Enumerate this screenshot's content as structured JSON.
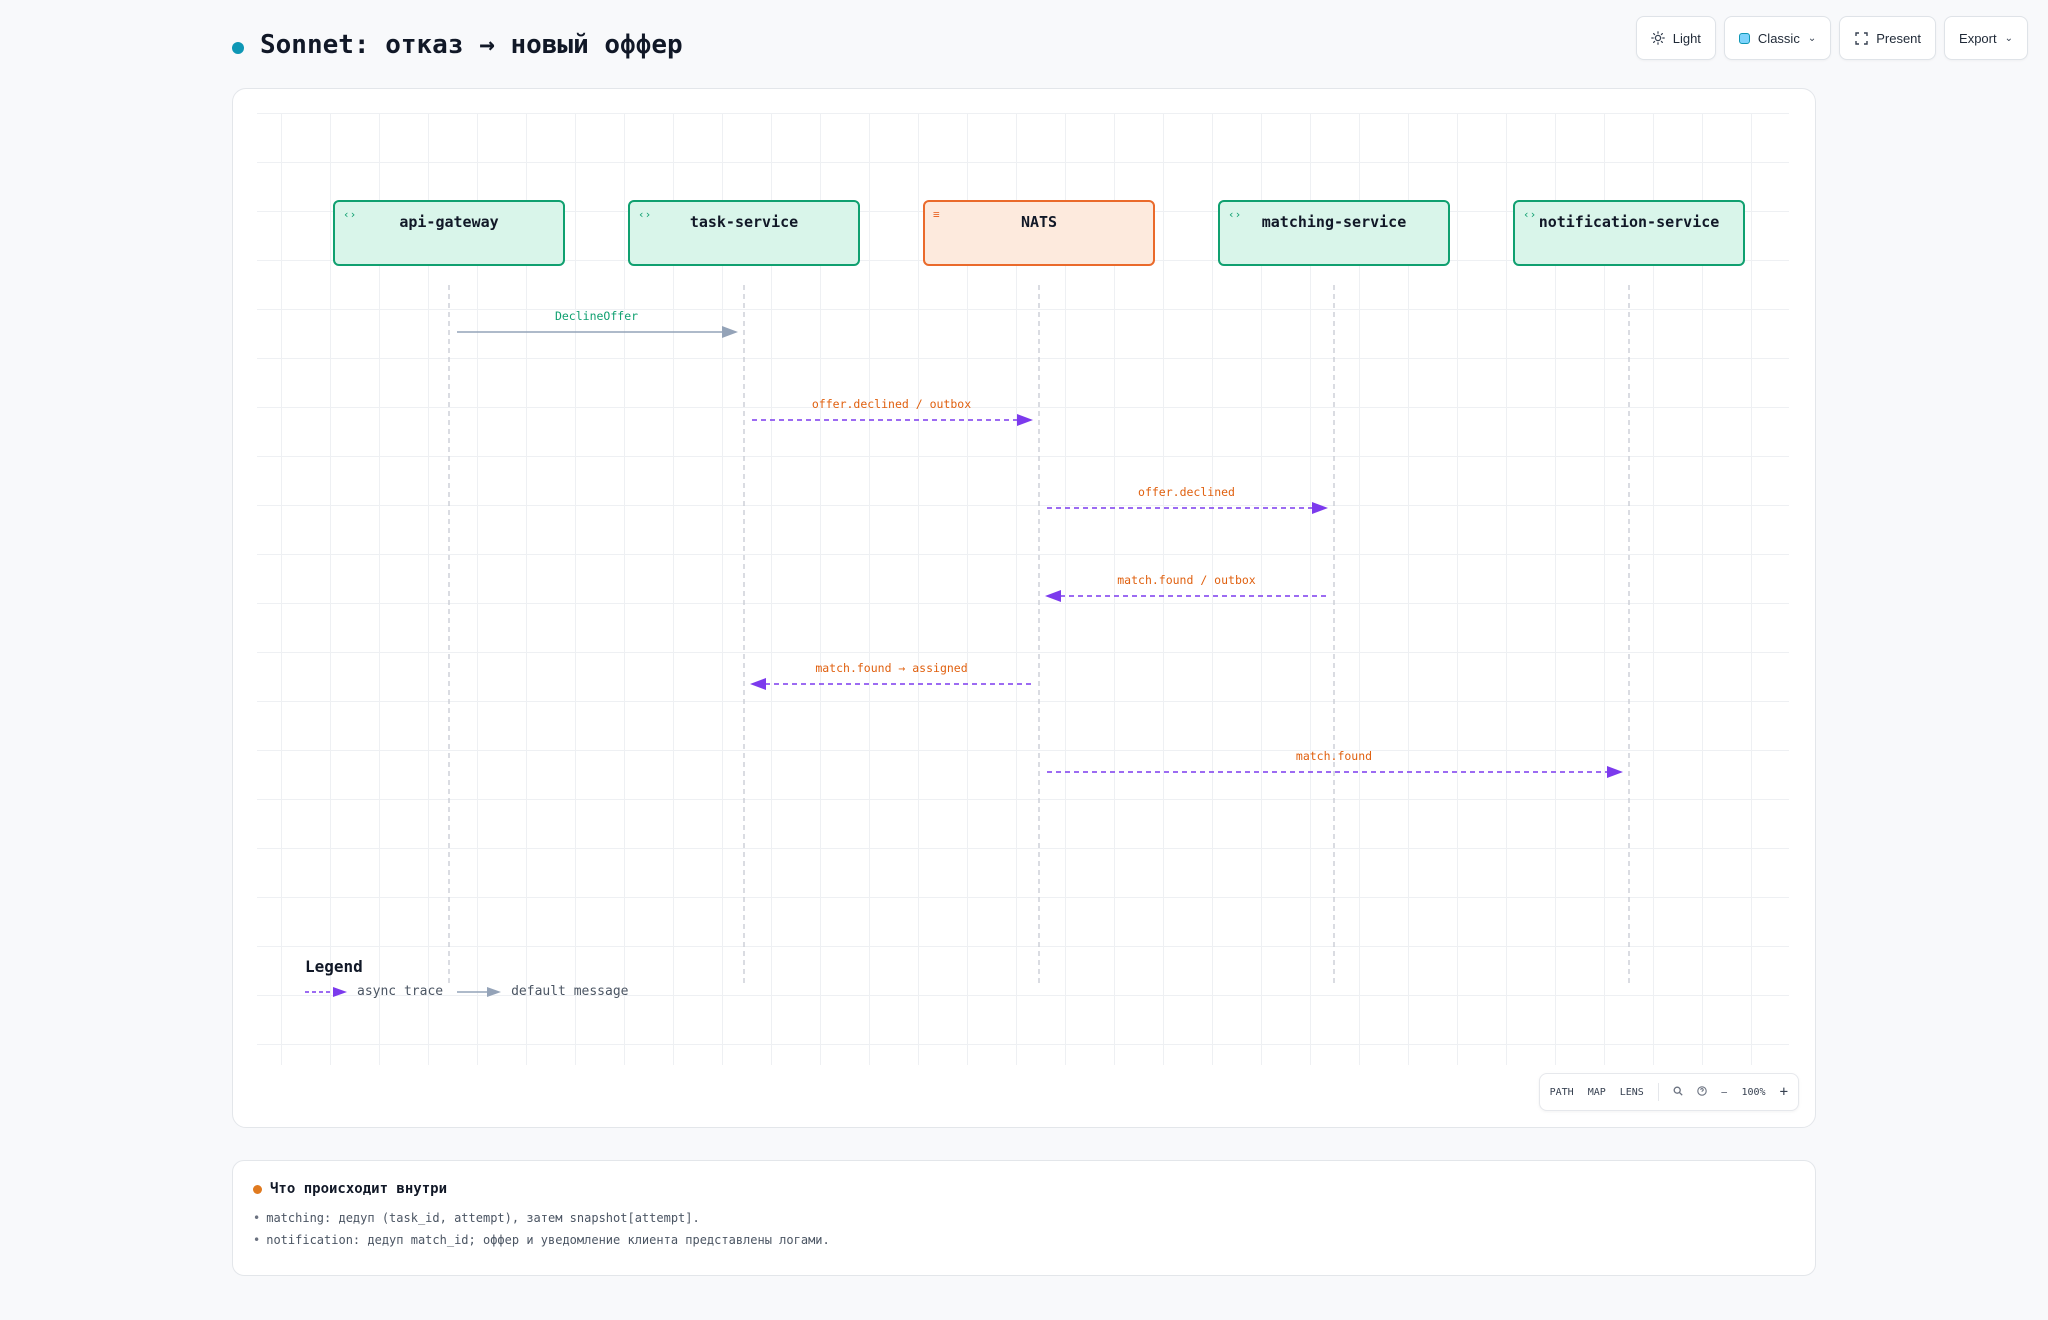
{
  "header": {
    "title": "Sonnet: отказ → новый оффер",
    "theme_label": "Light",
    "style_label": "Classic",
    "present_label": "Present",
    "export_label": "Export"
  },
  "participants": [
    {
      "name": "api-gateway",
      "kind": "service",
      "icon": "code-brackets-icon"
    },
    {
      "name": "task-service",
      "kind": "service",
      "icon": "code-brackets-icon"
    },
    {
      "name": "NATS",
      "kind": "queue",
      "icon": "queue-lines-icon"
    },
    {
      "name": "matching-service",
      "kind": "service",
      "icon": "code-brackets-icon"
    },
    {
      "name": "notification-service",
      "kind": "service",
      "icon": "code-brackets-icon"
    }
  ],
  "messages": [
    {
      "from": 0,
      "to": 1,
      "label": "DeclineOffer",
      "style": "default"
    },
    {
      "from": 1,
      "to": 2,
      "label": "offer.declined / outbox",
      "style": "async"
    },
    {
      "from": 2,
      "to": 3,
      "label": "offer.declined",
      "style": "async"
    },
    {
      "from": 3,
      "to": 2,
      "label": "match.found / outbox",
      "style": "async"
    },
    {
      "from": 2,
      "to": 1,
      "label": "match.found → assigned",
      "style": "async"
    },
    {
      "from": 2,
      "to": 4,
      "label": "match.found",
      "style": "async"
    }
  ],
  "legend": {
    "title": "Legend",
    "async_label": "async trace",
    "default_label": "default message"
  },
  "zoombar": {
    "path_label": "PATH",
    "map_label": "MAP",
    "lens_label": "LENS",
    "zoom_level": "100%",
    "minus_label": "−",
    "plus_label": "+"
  },
  "notes": {
    "title": "Что происходит внутри",
    "items": [
      "matching: дедуп (task_id, attempt), затем snapshot[attempt].",
      "notification: дедуп match_id; оффер и уведомление клиента представлены логами."
    ]
  },
  "colors": {
    "service_border": "#10a070",
    "service_fill": "#d9f5ea",
    "queue_border": "#ea6a2b",
    "queue_fill": "#fdeadd",
    "async_arrow": "#7c3aed",
    "default_arrow": "#94a3b8",
    "async_label": "#e0600f",
    "default_label": "#10a070"
  }
}
